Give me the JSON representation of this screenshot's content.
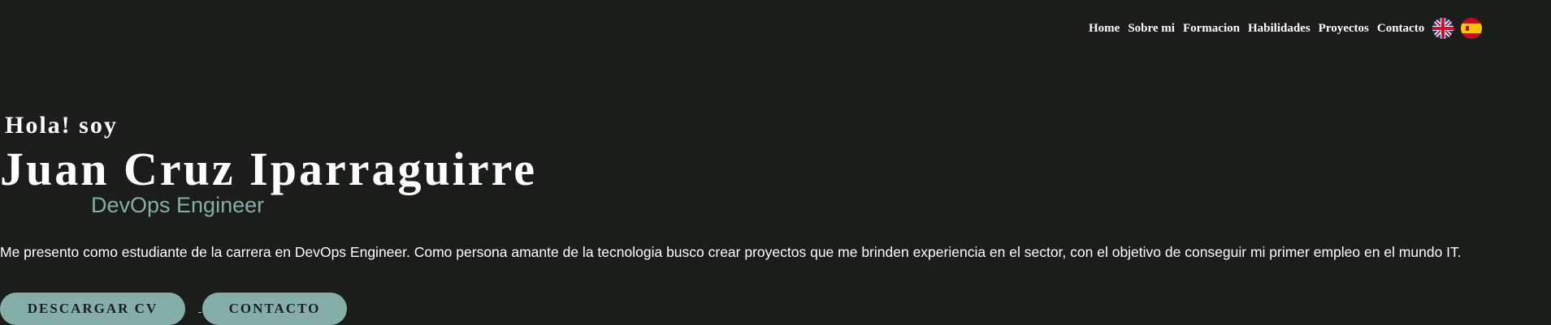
{
  "nav": {
    "items": [
      {
        "label": "Home"
      },
      {
        "label": "Sobre mi"
      },
      {
        "label": "Formacion"
      },
      {
        "label": "Habilidades"
      },
      {
        "label": "Proyectos"
      },
      {
        "label": "Contacto"
      }
    ],
    "languages": [
      {
        "icon": "uk-flag-icon"
      },
      {
        "icon": "spain-flag-icon"
      }
    ]
  },
  "hero": {
    "greeting": "Hola! soy",
    "name": "Juan Cruz Iparraguirre",
    "role": "DevOps Engineer",
    "intro": "Me presento como estudiante de la carrera en DevOps Engineer. Como persona amante de la tecnologia busco crear proyectos que me brinden experiencia en el sector, con el objetivo de conseguir mi primer empleo en el mundo IT."
  },
  "actions": {
    "download_cv": "DESCARGAR CV",
    "contact": "CONTACTO"
  },
  "colors": {
    "background": "#1b1d1a",
    "accent": "#86aea9",
    "text": "#ffffff"
  }
}
